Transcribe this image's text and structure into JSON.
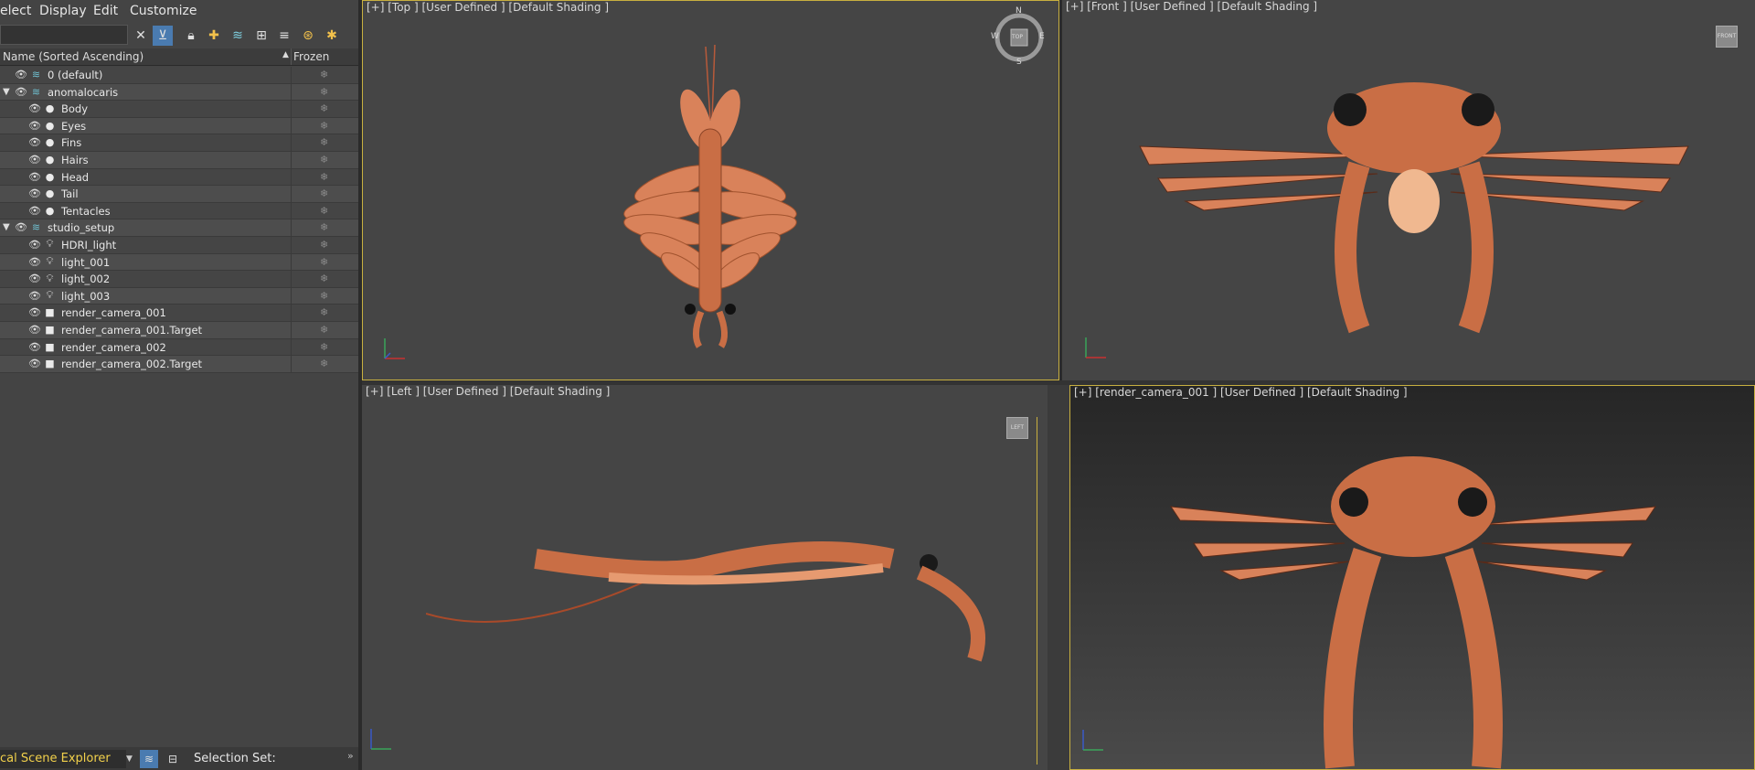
{
  "menu": {
    "select": "elect",
    "display": "Display",
    "edit": "Edit",
    "customize": "Customize"
  },
  "columns": {
    "name": "Name (Sorted Ascending)",
    "sort_indicator": "▲",
    "frozen": "Frozen"
  },
  "tree": [
    {
      "label": "0 (default)",
      "indent": 0,
      "icon": "layer-icon",
      "expand": ""
    },
    {
      "label": "anomalocaris",
      "indent": 0,
      "icon": "layer-icon",
      "expand": "▼"
    },
    {
      "label": "Body",
      "indent": 1,
      "icon": "sphere-icon",
      "expand": ""
    },
    {
      "label": "Eyes",
      "indent": 1,
      "icon": "sphere-icon",
      "expand": ""
    },
    {
      "label": "Fins",
      "indent": 1,
      "icon": "sphere-icon",
      "expand": ""
    },
    {
      "label": "Hairs",
      "indent": 1,
      "icon": "sphere-icon",
      "expand": ""
    },
    {
      "label": "Head",
      "indent": 1,
      "icon": "sphere-icon",
      "expand": ""
    },
    {
      "label": "Tail",
      "indent": 1,
      "icon": "sphere-icon",
      "expand": ""
    },
    {
      "label": "Tentacles",
      "indent": 1,
      "icon": "sphere-icon",
      "expand": ""
    },
    {
      "label": "studio_setup",
      "indent": 0,
      "icon": "layer-icon",
      "expand": "▼"
    },
    {
      "label": "HDRI_light",
      "indent": 1,
      "icon": "light-icon",
      "expand": ""
    },
    {
      "label": "light_001",
      "indent": 1,
      "icon": "light-icon",
      "expand": ""
    },
    {
      "label": "light_002",
      "indent": 1,
      "icon": "light-icon",
      "expand": ""
    },
    {
      "label": "light_003",
      "indent": 1,
      "icon": "light-icon",
      "expand": ""
    },
    {
      "label": "render_camera_001",
      "indent": 1,
      "icon": "camera-icon",
      "expand": ""
    },
    {
      "label": "render_camera_001.Target",
      "indent": 1,
      "icon": "camera-icon",
      "expand": ""
    },
    {
      "label": "render_camera_002",
      "indent": 1,
      "icon": "camera-icon",
      "expand": ""
    },
    {
      "label": "render_camera_002.Target",
      "indent": 1,
      "icon": "camera-icon",
      "expand": ""
    }
  ],
  "bottom": {
    "explorer": "cal Scene Explorer",
    "selection_set": "Selection Set:",
    "chevron": "»"
  },
  "viewports": {
    "top": "[+] [Top ] [User Defined ] [Default Shading ]",
    "front": "[+] [Front ] [User Defined ] [Default Shading ]",
    "left": "[+] [Left ] [User Defined ] [Default Shading ]",
    "camera": "[+] [render_camera_001 ] [User Defined ] [Default Shading ]"
  },
  "compass": {
    "n": "N",
    "s": "S",
    "e": "E",
    "w": "W"
  },
  "viewcube": {
    "top": "TOP",
    "front": "FRONT",
    "left": "LEFT"
  },
  "colors": {
    "accent_border": "#c8b040",
    "creature": "#d9825a",
    "highlight_text": "#f2d14b",
    "active_button": "#4a7bb0"
  }
}
